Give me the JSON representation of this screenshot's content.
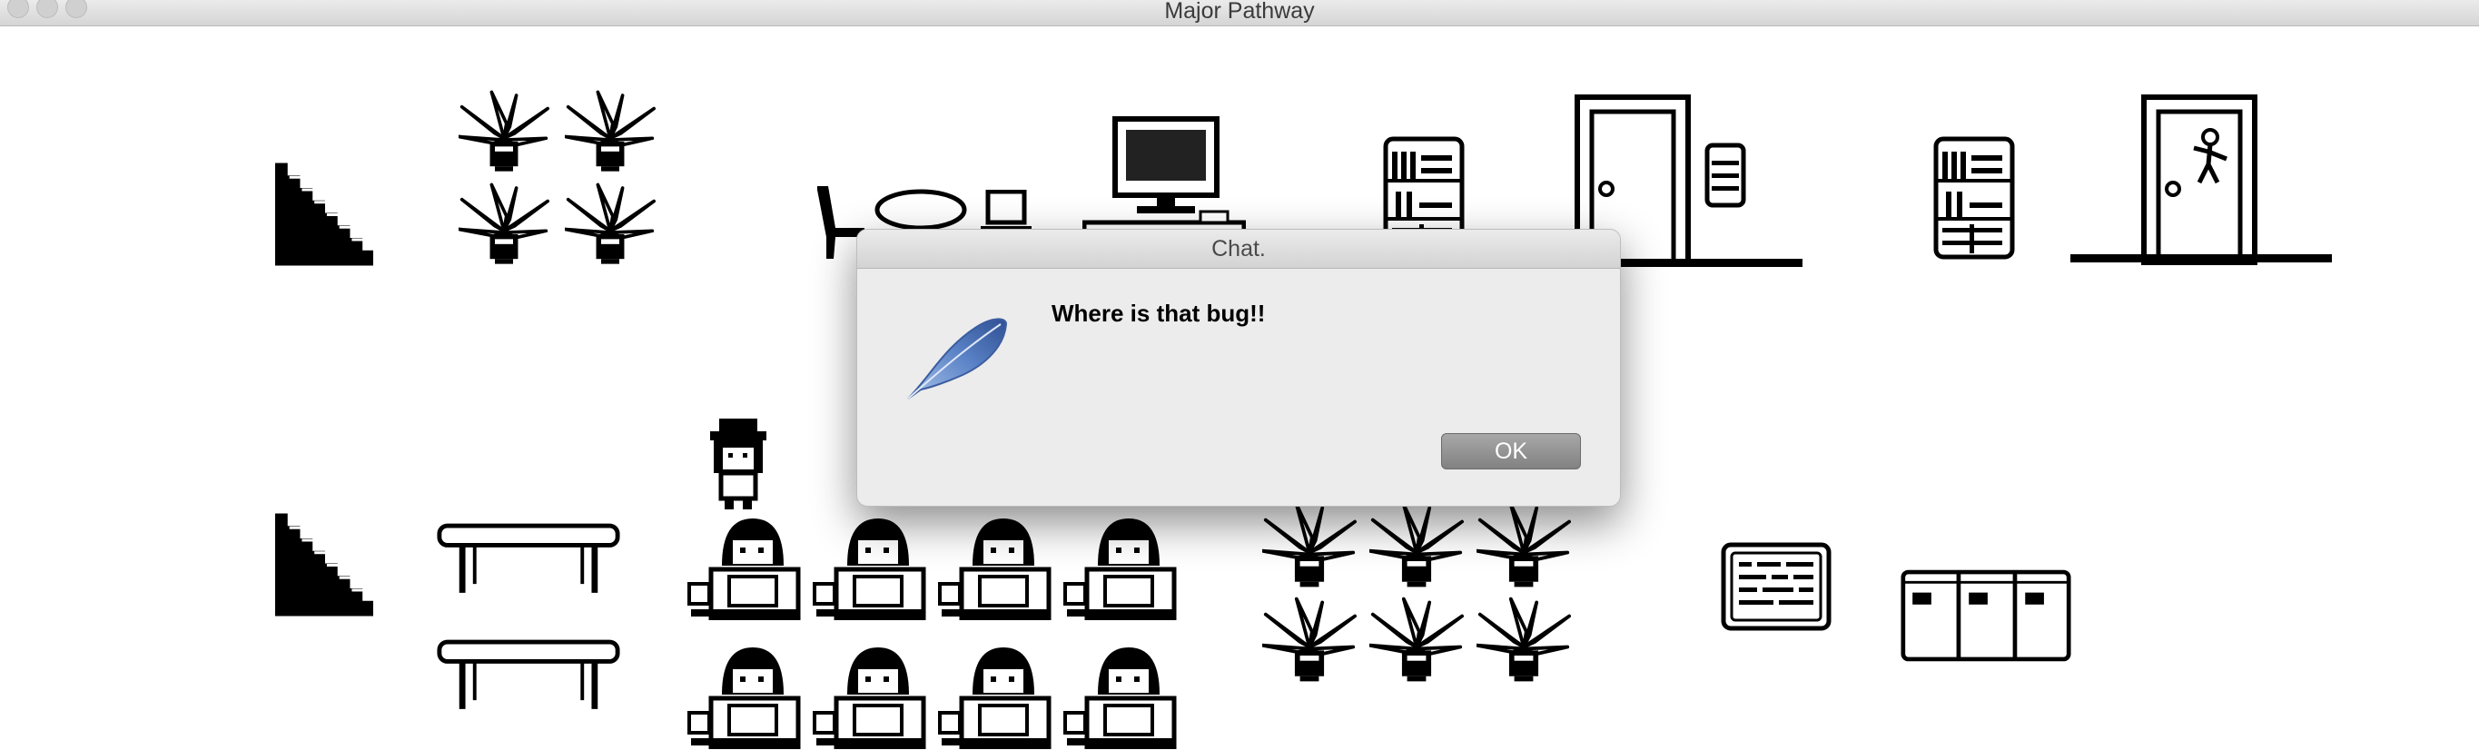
{
  "window": {
    "title": "Major Pathway"
  },
  "dialog": {
    "title": "Chat.",
    "message": "Where is that bug!!",
    "ok_label": "OK",
    "icon": "feather-icon"
  },
  "scene": {
    "objects": [
      "staircase-icon",
      "potted-plant-icon",
      "chair-icon",
      "table-icon",
      "laptop-icon",
      "computer-desk-icon",
      "bookshelf-icon",
      "door-icon",
      "locker-icon",
      "framed-poster-icon",
      "bench-icon",
      "student-at-desk-icon",
      "cabinet-icon",
      "character-icon"
    ]
  },
  "colors": {
    "sprite": "#000000",
    "dialog_bg": "#ececec",
    "ok_button": "#939393",
    "feather": "#4d73b8"
  }
}
